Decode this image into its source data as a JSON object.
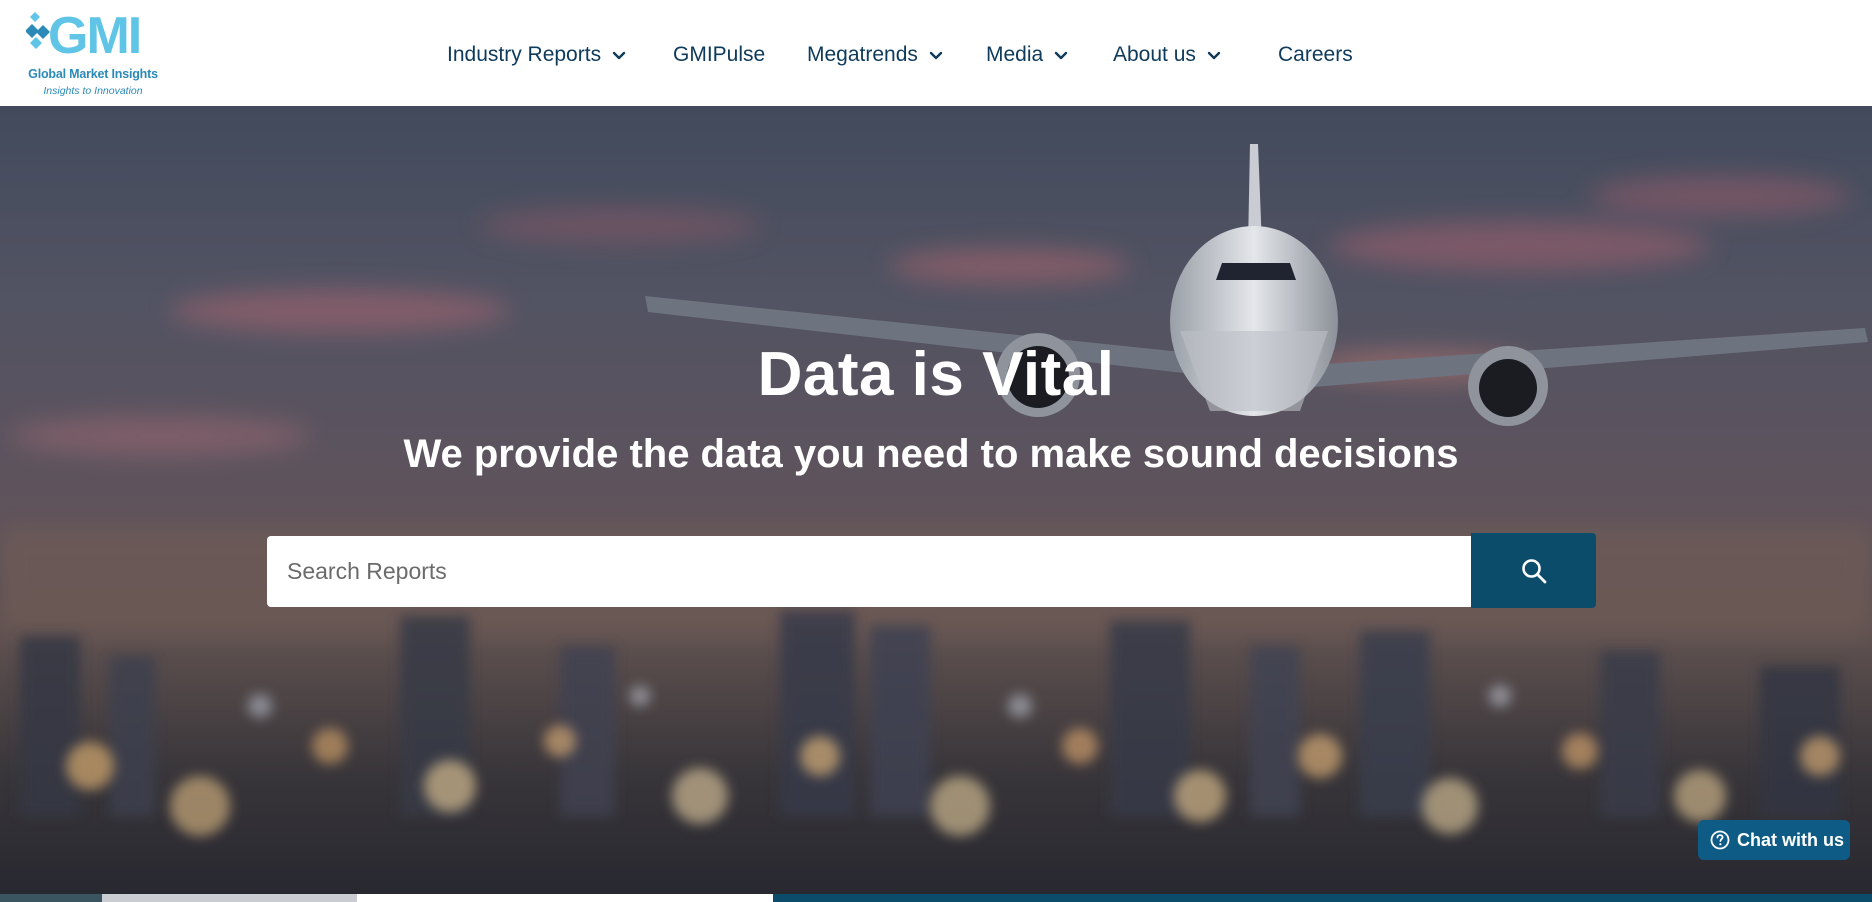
{
  "brand": {
    "logo_letters": "GMI",
    "name": "Global Market Insights",
    "tagline": "Insights to Innovation",
    "colors": {
      "logo_blue": "#2b8ab8",
      "logo_light": "#5fc4e6",
      "nav_text": "#0e3a5b",
      "button": "#0b4c6b"
    }
  },
  "nav": {
    "items": [
      {
        "label": "Industry Reports",
        "dropdown": true
      },
      {
        "label": "GMIPulse",
        "dropdown": false
      },
      {
        "label": "Megatrends",
        "dropdown": true
      },
      {
        "label": "Media",
        "dropdown": true
      },
      {
        "label": "About us",
        "dropdown": true
      },
      {
        "label": "Careers",
        "dropdown": false
      }
    ]
  },
  "hero": {
    "title": "Data is Vital",
    "subtitle": "We provide the data you need to make sound decisions",
    "background": "airplane-over-city-sunset",
    "search": {
      "placeholder": "Search Reports",
      "value": "",
      "button_icon": "search-icon"
    }
  },
  "chat": {
    "label": "Chat with us",
    "icon": "help-circle-icon"
  }
}
